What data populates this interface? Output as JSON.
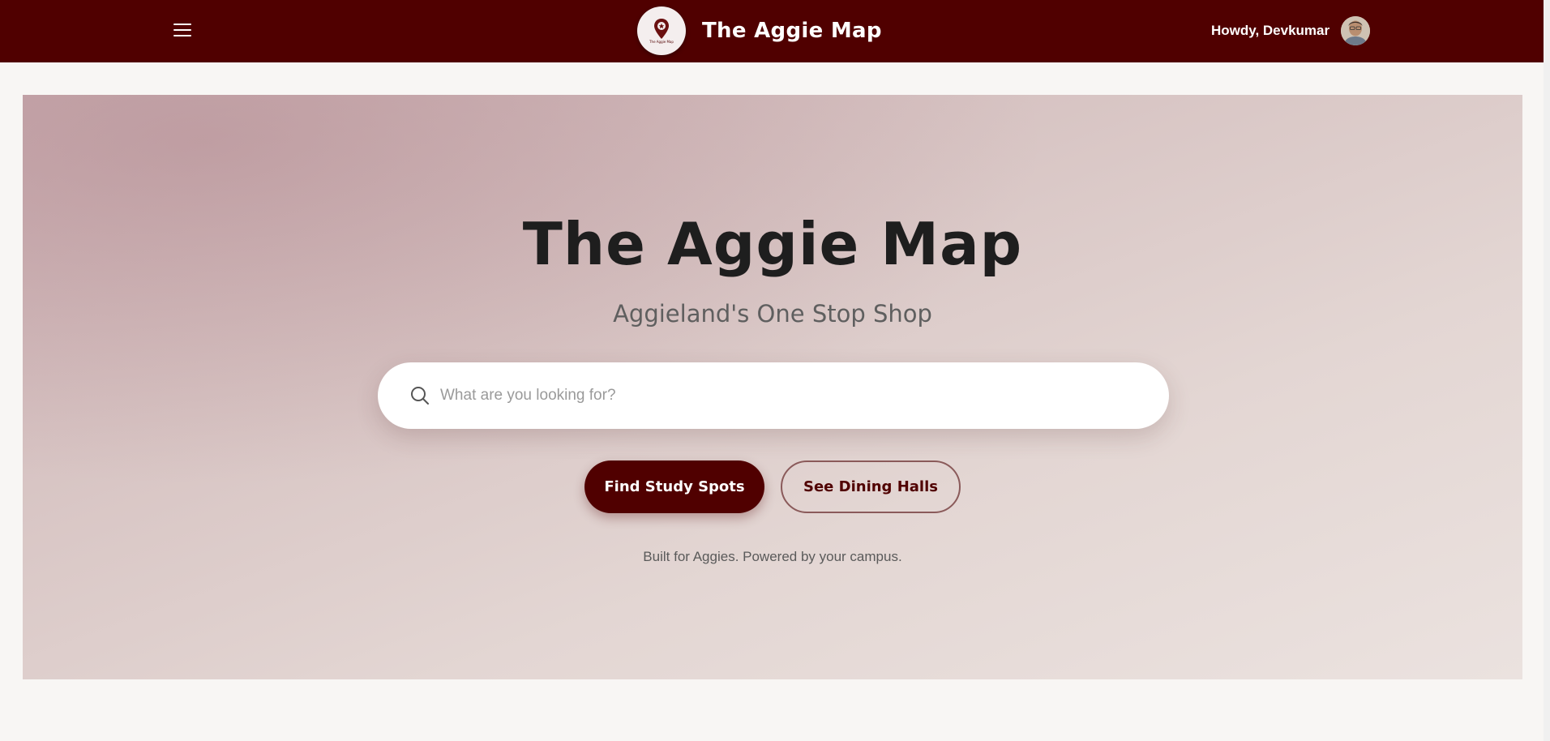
{
  "navbar": {
    "brand_title": "The Aggie Map",
    "logo_text": "The Aggie Map",
    "greeting": "Howdy, Devkumar",
    "background_color": "#500000"
  },
  "hero": {
    "title": "The Aggie Map",
    "subtitle": "Aggieland's One Stop Shop",
    "search": {
      "placeholder": "What are you looking for?",
      "value": ""
    },
    "primary_button_label": "Find Study Spots",
    "secondary_button_label": "See Dining Halls",
    "tagline": "Built for Aggies. Powered by your campus."
  },
  "icons": {
    "menu": "hamburger-menu-icon",
    "search": "search-icon",
    "logo": "map-pin-icon"
  },
  "colors": {
    "maroon": "#500000",
    "page_background": "#f8f6f4"
  }
}
